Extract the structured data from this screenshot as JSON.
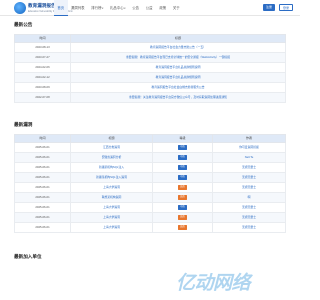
{
  "header": {
    "brand": "教育漏洞报告平台",
    "brand_sub": "Education Vulnerability Reporting Platform",
    "nav": [
      {
        "label": "首页",
        "active": true,
        "caret": false
      },
      {
        "label": "漏洞列表",
        "active": false,
        "caret": false
      },
      {
        "label": "排行榜",
        "active": false,
        "caret": true
      },
      {
        "label": "礼品中心",
        "active": false,
        "caret": true
      },
      {
        "label": "公告",
        "active": false,
        "caret": false
      },
      {
        "label": "公益",
        "active": false,
        "caret": false
      },
      {
        "label": "政策",
        "active": false,
        "caret": false
      },
      {
        "label": "关于",
        "active": false,
        "caret": false
      }
    ],
    "register_label": "注册",
    "login_label": "登录"
  },
  "announcements": {
    "title": "最新公告",
    "columns": [
      "时间",
      "标题"
    ],
    "rows": [
      {
        "date": "2023-08-13",
        "title": "教育漏洞报告平台社会力量志愿公告（一五）"
      },
      {
        "date": "2023-07-27",
        "title": "重要提醒！教育漏洞报告平台现已支持全球统一的安全通报（WebActivity）一键提报"
      },
      {
        "date": "2024-02-06",
        "title": "教育漏洞报告平台礼品兑换规则说明"
      },
      {
        "date": "2024-02-12",
        "title": "教育漏洞报告平台礼品兑换规则说明"
      },
      {
        "date": "2023-08-09",
        "title": "教育漏洞报告平台社会白帽志愿者服务公告"
      },
      {
        "date": "2022-07-08",
        "title": "重要提醒！关注教育漏洞报告平台官方微信公众号，及时获取漏洞处理进展通知"
      }
    ]
  },
  "vulns": {
    "title": "最新漏洞",
    "columns": [
      "时间",
      "标题",
      "等级",
      "作者"
    ],
    "rows": [
      {
        "date": "2025-06-01",
        "title": "江西分类漏洞",
        "level": "中危",
        "level_color": "#2b6cc4",
        "author": "你可爱漏洞挖掘"
      },
      {
        "date": "2025-06-01",
        "title": "安徽省漏洞分析",
        "level": "中危",
        "level_color": "#2b6cc4",
        "author": "NeCTe"
      },
      {
        "date": "2025-06-01",
        "title": "新疆某机构SQL注入",
        "level": "中危",
        "level_color": "#2b6cc4",
        "author": "无视天量士"
      },
      {
        "date": "2025-06-01",
        "title": "新疆某机构SQL注入漏洞",
        "level": "中危",
        "level_color": "#2b6cc4",
        "author": "无视天量士"
      },
      {
        "date": "2025-06-01",
        "title": "上海大学漏洞",
        "level": "高危",
        "level_color": "#e8762d",
        "author": "无视天量士"
      },
      {
        "date": "2025-06-01",
        "title": "联想某机构漏洞",
        "level": "高危",
        "level_color": "#e8762d",
        "author": "啊"
      },
      {
        "date": "2025-06-01",
        "title": "上海大学漏洞",
        "level": "中危",
        "level_color": "#2b6cc4",
        "author": "无视天量士"
      },
      {
        "date": "2025-06-01",
        "title": "上海大学漏洞",
        "level": "高危",
        "level_color": "#e8762d",
        "author": "无视天量士"
      },
      {
        "date": "2025-06-01",
        "title": "上海大学漏洞",
        "level": "高危",
        "level_color": "#e8762d",
        "author": "无视天量士"
      }
    ]
  },
  "units": {
    "title": "最新加入单位"
  },
  "watermark": "亿动网络"
}
